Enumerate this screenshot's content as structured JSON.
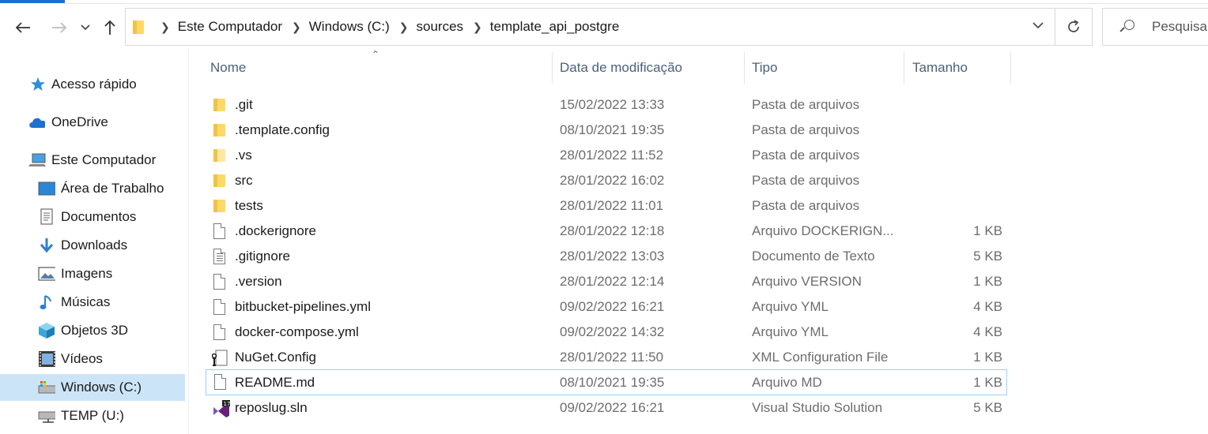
{
  "toolbar": {
    "back_icon": "arrow-left-icon",
    "forward_icon": "arrow-right-icon",
    "recent_icon": "chevron-down-icon",
    "up_icon": "arrow-up-icon",
    "refresh_icon": "refresh-icon"
  },
  "address": {
    "crumbs": [
      "Este Computador",
      "Windows (C:)",
      "sources",
      "template_api_postgre"
    ]
  },
  "search": {
    "placeholder": "Pesquisar"
  },
  "sidebar": {
    "items": [
      {
        "label": "Acesso rápido",
        "icon": "star-icon"
      },
      {
        "label": "OneDrive",
        "icon": "cloud-icon"
      },
      {
        "label": "Este Computador",
        "icon": "computer-icon"
      },
      {
        "label": "Área de Trabalho",
        "icon": "desktop-icon"
      },
      {
        "label": "Documentos",
        "icon": "documents-icon"
      },
      {
        "label": "Downloads",
        "icon": "download-icon"
      },
      {
        "label": "Imagens",
        "icon": "pictures-icon"
      },
      {
        "label": "Músicas",
        "icon": "music-icon"
      },
      {
        "label": "Objetos 3D",
        "icon": "cube-icon"
      },
      {
        "label": "Vídeos",
        "icon": "video-icon"
      },
      {
        "label": "Windows (C:)",
        "icon": "drive-icon"
      },
      {
        "label": "TEMP (U:)",
        "icon": "network-drive-icon"
      }
    ],
    "selected": "Windows (C:)"
  },
  "columns": {
    "name": "Nome",
    "date": "Data de modificação",
    "type": "Tipo",
    "size": "Tamanho"
  },
  "files": [
    {
      "name": ".git",
      "date": "15/02/2022 13:33",
      "type": "Pasta de arquivos",
      "size": "",
      "icon": "folder-icon"
    },
    {
      "name": ".template.config",
      "date": "08/10/2021 19:35",
      "type": "Pasta de arquivos",
      "size": "",
      "icon": "folder-icon"
    },
    {
      "name": ".vs",
      "date": "28/01/2022 11:52",
      "type": "Pasta de arquivos",
      "size": "",
      "icon": "folder-icon"
    },
    {
      "name": "src",
      "date": "28/01/2022 16:02",
      "type": "Pasta de arquivos",
      "size": "",
      "icon": "folder-icon"
    },
    {
      "name": "tests",
      "date": "28/01/2022 11:01",
      "type": "Pasta de arquivos",
      "size": "",
      "icon": "folder-icon"
    },
    {
      "name": ".dockerignore",
      "date": "28/01/2022 12:18",
      "type": "Arquivo DOCKERIGN...",
      "size": "1 KB",
      "icon": "file-icon"
    },
    {
      "name": ".gitignore",
      "date": "28/01/2022 13:03",
      "type": "Documento de Texto",
      "size": "5 KB",
      "icon": "text-file-icon"
    },
    {
      "name": ".version",
      "date": "28/01/2022 12:14",
      "type": "Arquivo VERSION",
      "size": "1 KB",
      "icon": "file-icon"
    },
    {
      "name": "bitbucket-pipelines.yml",
      "date": "09/02/2022 16:21",
      "type": "Arquivo YML",
      "size": "4 KB",
      "icon": "file-icon"
    },
    {
      "name": "docker-compose.yml",
      "date": "09/02/2022 14:32",
      "type": "Arquivo YML",
      "size": "4 KB",
      "icon": "file-icon"
    },
    {
      "name": "NuGet.Config",
      "date": "28/01/2022 11:50",
      "type": "XML Configuration File",
      "size": "1 KB",
      "icon": "config-file-icon"
    },
    {
      "name": "README.md",
      "date": "08/10/2021 19:35",
      "type": "Arquivo MD",
      "size": "1 KB",
      "icon": "file-icon"
    },
    {
      "name": "reposlug.sln",
      "date": "09/02/2022 16:21",
      "type": "Visual Studio Solution",
      "size": "5 KB",
      "icon": "visual-studio-solution-icon"
    }
  ],
  "focused_file": "README.md",
  "colors": {
    "accent": "#1f6fd1",
    "selected_bg": "#cce4f7",
    "focus_border": "#99d1ff",
    "header_text": "#4c607a",
    "muted_text": "#6d6d6d",
    "folder": "#ffd968"
  }
}
